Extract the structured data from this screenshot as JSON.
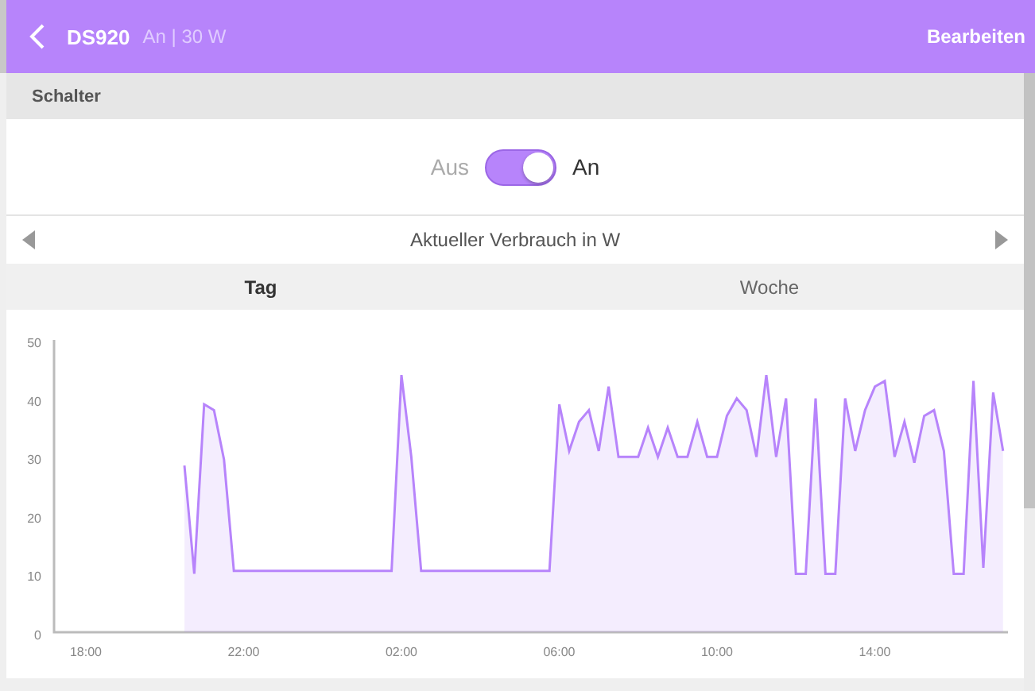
{
  "header": {
    "title": "DS920",
    "subtitle": "An | 30 W",
    "action": "Bearbeiten"
  },
  "section": {
    "title": "Schalter"
  },
  "switch": {
    "off_label": "Aus",
    "on_label": "An",
    "on": true
  },
  "chart_nav": {
    "title": "Aktueller Verbrauch in W"
  },
  "tabs": [
    {
      "label": "Tag",
      "selected": true
    },
    {
      "label": "Woche",
      "selected": false
    }
  ],
  "chart_data": {
    "type": "area",
    "ylim": [
      0,
      50
    ],
    "yticks": [
      0,
      10,
      20,
      30,
      40,
      50
    ],
    "categories": [
      null,
      null,
      "18:00",
      null,
      null,
      null,
      null,
      null,
      null,
      null,
      null,
      null,
      null,
      null,
      null,
      null,
      null,
      null,
      "22:00",
      null,
      null,
      null,
      null,
      null,
      null,
      null,
      null,
      null,
      null,
      null,
      null,
      null,
      null,
      null,
      "02:00",
      null,
      null,
      null,
      null,
      null,
      null,
      null,
      null,
      null,
      null,
      null,
      null,
      null,
      null,
      null,
      "06:00",
      null,
      null,
      null,
      null,
      null,
      null,
      null,
      null,
      null,
      null,
      null,
      null,
      null,
      null,
      null,
      "10:00",
      null,
      null,
      null,
      null,
      null,
      null,
      null,
      null,
      null,
      null,
      null,
      null,
      null,
      null,
      null,
      "14:00",
      null,
      null,
      null,
      null,
      null,
      null,
      null,
      null,
      null,
      null,
      null,
      null,
      null
    ],
    "series": [
      {
        "color": "#b784fb",
        "values": [
          null,
          null,
          null,
          null,
          null,
          null,
          null,
          null,
          null,
          null,
          null,
          null,
          28.5,
          10,
          39,
          38,
          29.5,
          10.5,
          10.5,
          10.5,
          10.5,
          10.5,
          10.5,
          10.5,
          10.5,
          10.5,
          10.5,
          10.5,
          10.5,
          10.5,
          10.5,
          10.5,
          10.5,
          10.5,
          44,
          30,
          10.5,
          10.5,
          10.5,
          10.5,
          10.5,
          10.5,
          10.5,
          10.5,
          10.5,
          10.5,
          10.5,
          10.5,
          10.5,
          10.5,
          39,
          31,
          36,
          38,
          31,
          42,
          30,
          30,
          30,
          35,
          30,
          35,
          30,
          30,
          36,
          30,
          30,
          37,
          40,
          38,
          30,
          44,
          30,
          40,
          10,
          10,
          40,
          10,
          10,
          40,
          31,
          38,
          42,
          43,
          30,
          36,
          29,
          37,
          38,
          31,
          10,
          10,
          43,
          11,
          41,
          31
        ]
      }
    ]
  }
}
